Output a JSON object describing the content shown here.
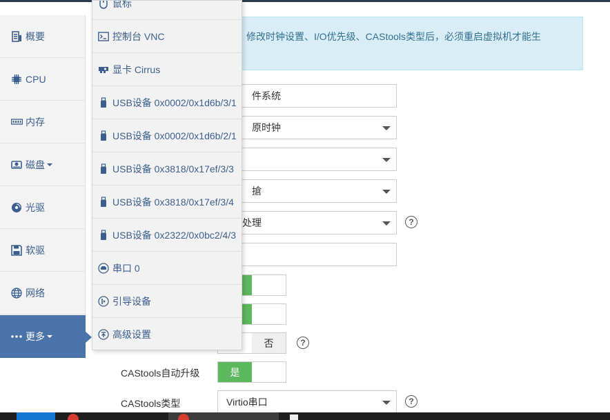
{
  "sidebar": {
    "items": [
      {
        "label": "概要",
        "icon": "summary-icon"
      },
      {
        "label": "CPU",
        "icon": "cpu-icon"
      },
      {
        "label": "内存",
        "icon": "memory-icon"
      },
      {
        "label": "磁盘",
        "icon": "disk-icon",
        "has_caret": true
      },
      {
        "label": "光驱",
        "icon": "cdrom-icon"
      },
      {
        "label": "软驱",
        "icon": "floppy-icon"
      },
      {
        "label": "网络",
        "icon": "network-icon"
      },
      {
        "label": "更多",
        "icon": "more-icon",
        "has_caret": true,
        "active": true
      }
    ],
    "active_color": "#4a73a9",
    "text_color": "#3a5f8e"
  },
  "banner": {
    "text": "停状态，修改时钟设置、I/O优先级、CAStools类型后，必须重启虚拟机才能生"
  },
  "form": {
    "field1_value": "件系统",
    "field2_value": "原时钟",
    "field3_value": "",
    "field4_value": "搶",
    "field5_value": "处理",
    "field6_value": "",
    "toggle_no_label": "否",
    "castools_upgrade_label": "CAStools自动升级",
    "castools_upgrade_value": "是",
    "castools_type_label": "CAStools类型",
    "castools_type_value": "Virtio串口",
    "help_glyph": "?"
  },
  "menu": {
    "items": [
      {
        "label": "鼠标",
        "icon": "mouse-icon"
      },
      {
        "label": "控制台 VNC",
        "icon": "console-icon"
      },
      {
        "label": "显卡 Cirrus",
        "icon": "graphics-card-icon"
      },
      {
        "label": "USB设备 0x0002/0x1d6b/3/1",
        "icon": "usb-icon"
      },
      {
        "label": "USB设备 0x0002/0x1d6b/2/1",
        "icon": "usb-icon"
      },
      {
        "label": "USB设备 0x3818/0x17ef/3/3",
        "icon": "usb-icon"
      },
      {
        "label": "USB设备 0x3818/0x17ef/3/4",
        "icon": "usb-icon"
      },
      {
        "label": "USB设备 0x2322/0x0bc2/4/3",
        "icon": "usb-icon"
      },
      {
        "label": "串口 0",
        "icon": "serial-port-icon"
      },
      {
        "label": "引导设备",
        "icon": "boot-device-icon"
      },
      {
        "label": "高级设置",
        "icon": "advanced-settings-icon"
      }
    ]
  },
  "colors": {
    "toggle_on": "#5cb85c",
    "banner_bg": "#d9edf7",
    "banner_text": "#31708f"
  }
}
